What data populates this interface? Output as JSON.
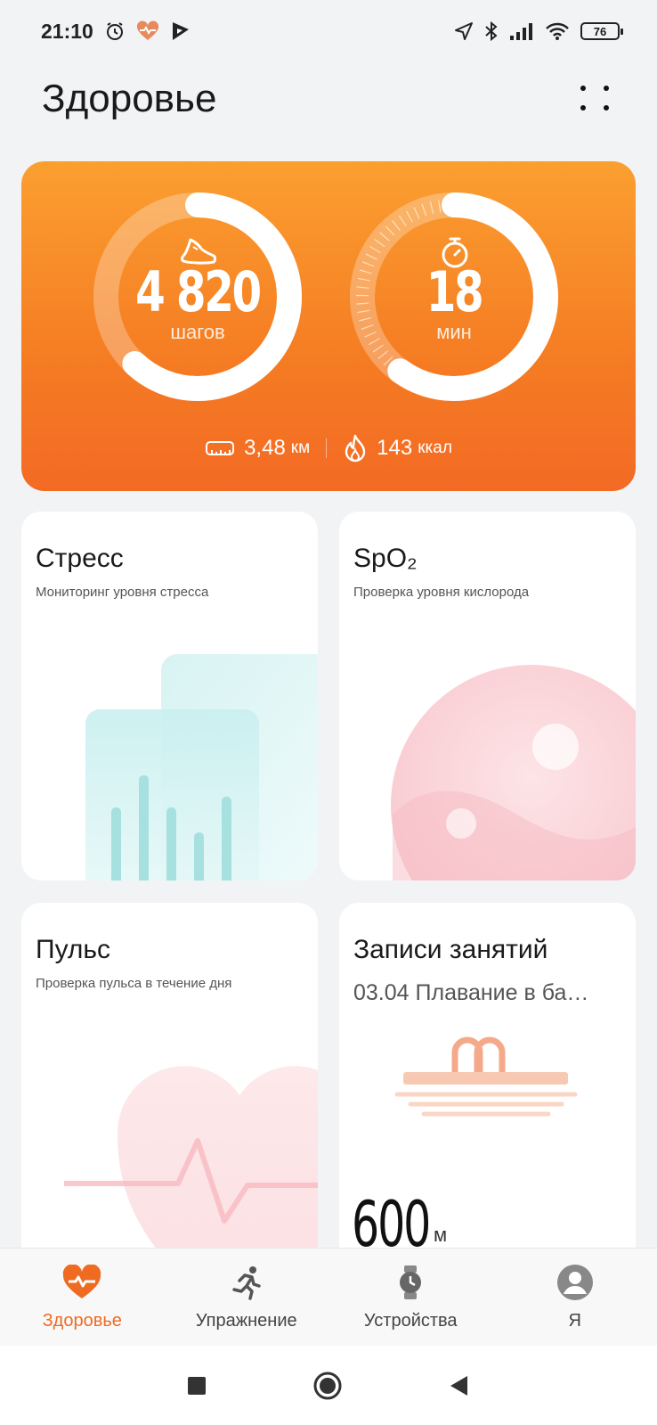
{
  "status_bar": {
    "time": "21:10",
    "battery": "76",
    "left_icons": [
      "alarm-icon",
      "health-heart-icon",
      "play-icon"
    ],
    "right_icons": [
      "location-icon",
      "bluetooth-icon",
      "signal-icon",
      "wifi-icon",
      "battery-icon"
    ]
  },
  "header": {
    "title": "Здоровье",
    "menu_icon": "more-grid-icon"
  },
  "activity": {
    "steps": {
      "value": "4 820",
      "unit": "шагов",
      "icon": "shoe-icon",
      "progress": 0.62
    },
    "minutes": {
      "value": "18",
      "unit": "мин",
      "icon": "stopwatch-icon",
      "progress": 0.6
    },
    "distance": {
      "value": "3,48",
      "unit": "км",
      "icon": "ruler-icon"
    },
    "calories": {
      "value": "143",
      "unit": "ккал",
      "icon": "flame-icon"
    },
    "colors": {
      "start": "#fb9f30",
      "end": "#f36a24"
    }
  },
  "tiles": {
    "stress": {
      "title": "Стресс",
      "subtitle": "Мониторинг уровня стресса"
    },
    "spo2": {
      "title": "SpO₂",
      "subtitle": "Проверка уровня кислорода"
    },
    "pulse": {
      "title": "Пульс",
      "subtitle": "Проверка пульса в течение дня"
    },
    "workouts": {
      "title": "Записи занятий",
      "subtitle": "03.04 Плавание в ба…",
      "value": "600",
      "unit": "м"
    }
  },
  "bottom_nav": {
    "items": [
      {
        "label": "Здоровье",
        "icon": "heart-pulse-icon",
        "active": true
      },
      {
        "label": "Упражнение",
        "icon": "runner-icon",
        "active": false
      },
      {
        "label": "Устройства",
        "icon": "watch-icon",
        "active": false
      },
      {
        "label": "Я",
        "icon": "avatar-icon",
        "active": false
      }
    ],
    "accent": "#ef6b22"
  },
  "system_nav": {
    "buttons": [
      "recent-apps-icon",
      "home-icon",
      "back-icon"
    ]
  }
}
